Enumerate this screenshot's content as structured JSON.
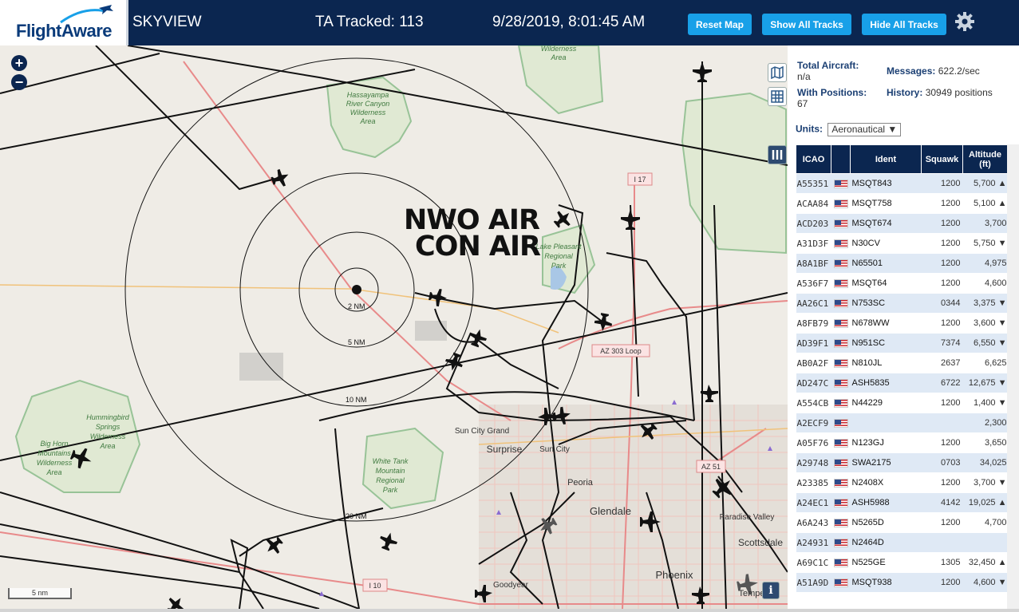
{
  "header": {
    "logo_text": "FlightAware",
    "app_name": "SKYVIEW",
    "tracked": "TA Tracked: 113",
    "datetime": "9/28/2019, 8:01:45 AM",
    "btn_reset": "Reset Map",
    "btn_show": "Show All Tracks",
    "btn_hide": "Hide All Tracks",
    "settings_icon": "gear-icon"
  },
  "map": {
    "zoom_in": "+",
    "zoom_out": "−",
    "overlay_line1": "NWO AIR",
    "overlay_line2": "CON AIR",
    "scale_label": "5 nm",
    "ring_labels": [
      "2 NM",
      "5 NM",
      "10 NM",
      "20 NM"
    ],
    "places": [
      {
        "text": "Hassayampa"
      },
      {
        "text": "River Canyon"
      },
      {
        "text": "Wilderness"
      },
      {
        "text": "Area"
      },
      {
        "text": "Wilderness"
      },
      {
        "text": "Area"
      },
      {
        "text": "Lake Pleasant"
      },
      {
        "text": "Regional"
      },
      {
        "text": "Park"
      },
      {
        "text": "Hummingbird"
      },
      {
        "text": "Springs"
      },
      {
        "text": "Wilderness"
      },
      {
        "text": "Area"
      },
      {
        "text": "Big Horn"
      },
      {
        "text": "Mountains"
      },
      {
        "text": "Wilderness"
      },
      {
        "text": "Area"
      },
      {
        "text": "White Tank"
      },
      {
        "text": "Mountain"
      },
      {
        "text": "Regional"
      },
      {
        "text": "Park"
      },
      {
        "text": "Sun City Grand"
      },
      {
        "text": "Sun City"
      },
      {
        "text": "Surprise"
      },
      {
        "text": "Peoria"
      },
      {
        "text": "Glendale"
      },
      {
        "text": "Paradise Valley"
      },
      {
        "text": "Scottsdale"
      },
      {
        "text": "Phoenix"
      },
      {
        "text": "Goodyear"
      },
      {
        "text": "Tempe"
      }
    ],
    "road_labels": [
      "I 17",
      "AZ 303 Loop",
      "AZ 51",
      "I 10"
    ],
    "icons": {
      "map_layers": "map-icon",
      "grid": "grid-icon",
      "columns": "columns-icon",
      "info": "info-icon",
      "plus": "plus-icon",
      "minus": "minus-icon"
    }
  },
  "panel": {
    "total_aircraft_label": "Total Aircraft:",
    "total_aircraft_value": "n/a",
    "messages_label": "Messages:",
    "messages_value": "622.2/sec",
    "with_positions_label": "With Positions:",
    "with_positions_value": "67",
    "history_label": "History:",
    "history_value": "30949 positions",
    "units_label": "Units:",
    "units_value": "Aeronautical",
    "columns": [
      "ICAO",
      "",
      "Ident",
      "Squawk",
      "Altitude (ft)"
    ],
    "rows": [
      {
        "icao": "A55351",
        "ident": "MSQT843",
        "squawk": "1200",
        "alt": "5,700",
        "trend": "▲"
      },
      {
        "icao": "ACAA84",
        "ident": "MSQT758",
        "squawk": "1200",
        "alt": "5,100",
        "trend": "▲"
      },
      {
        "icao": "ACD203",
        "ident": "MSQT674",
        "squawk": "1200",
        "alt": "3,700",
        "trend": ""
      },
      {
        "icao": "A31D3F",
        "ident": "N30CV",
        "squawk": "1200",
        "alt": "5,750",
        "trend": "▼"
      },
      {
        "icao": "A8A1BF",
        "ident": "N65501",
        "squawk": "1200",
        "alt": "4,975",
        "trend": ""
      },
      {
        "icao": "A536F7",
        "ident": "MSQT64",
        "squawk": "1200",
        "alt": "4,600",
        "trend": ""
      },
      {
        "icao": "AA26C1",
        "ident": "N753SC",
        "squawk": "0344",
        "alt": "3,375",
        "trend": "▼"
      },
      {
        "icao": "A8FB79",
        "ident": "N678WW",
        "squawk": "1200",
        "alt": "3,600",
        "trend": "▼"
      },
      {
        "icao": "AD39F1",
        "ident": "N951SC",
        "squawk": "7374",
        "alt": "6,550",
        "trend": "▼"
      },
      {
        "icao": "AB0A2F",
        "ident": "N810JL",
        "squawk": "2637",
        "alt": "6,625",
        "trend": ""
      },
      {
        "icao": "AD247C",
        "ident": "ASH5835",
        "squawk": "6722",
        "alt": "12,675",
        "trend": "▼"
      },
      {
        "icao": "A554CB",
        "ident": "N44229",
        "squawk": "1200",
        "alt": "1,400",
        "trend": "▼"
      },
      {
        "icao": "A2ECF9",
        "ident": "",
        "squawk": "",
        "alt": "2,300",
        "trend": ""
      },
      {
        "icao": "A05F76",
        "ident": "N123GJ",
        "squawk": "1200",
        "alt": "3,650",
        "trend": ""
      },
      {
        "icao": "A29748",
        "ident": "SWA2175",
        "squawk": "0703",
        "alt": "34,025",
        "trend": ""
      },
      {
        "icao": "A23385",
        "ident": "N2408X",
        "squawk": "1200",
        "alt": "3,700",
        "trend": "▼"
      },
      {
        "icao": "A24EC1",
        "ident": "ASH5988",
        "squawk": "4142",
        "alt": "19,025",
        "trend": "▲"
      },
      {
        "icao": "A6A243",
        "ident": "N5265D",
        "squawk": "1200",
        "alt": "4,700",
        "trend": ""
      },
      {
        "icao": "A24931",
        "ident": "N2464D",
        "squawk": "",
        "alt": "",
        "trend": ""
      },
      {
        "icao": "A69C1C",
        "ident": "N525GE",
        "squawk": "1305",
        "alt": "32,450",
        "trend": "▲"
      },
      {
        "icao": "A51A9D",
        "ident": "MSQT938",
        "squawk": "1200",
        "alt": "4,600",
        "trend": "▼"
      }
    ]
  }
}
